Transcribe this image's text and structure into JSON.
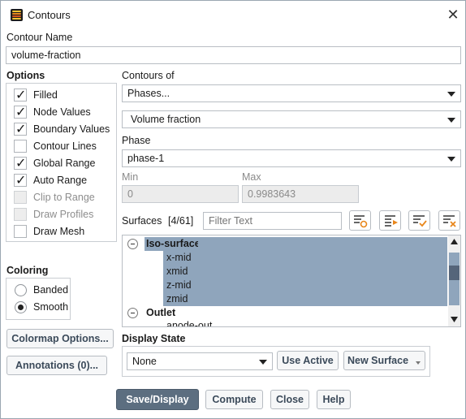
{
  "window": {
    "title": "Contours",
    "close_glyph": "✕",
    "icon": "contours-app-icon"
  },
  "contour_name": {
    "label": "Contour Name",
    "value": "volume-fraction"
  },
  "options": {
    "label": "Options",
    "items": [
      {
        "label": "Filled",
        "checked": true,
        "enabled": true
      },
      {
        "label": "Node Values",
        "checked": true,
        "enabled": true
      },
      {
        "label": "Boundary Values",
        "checked": true,
        "enabled": true
      },
      {
        "label": "Contour Lines",
        "checked": false,
        "enabled": true
      },
      {
        "label": "Global Range",
        "checked": true,
        "enabled": true
      },
      {
        "label": "Auto Range",
        "checked": true,
        "enabled": true
      },
      {
        "label": "Clip to Range",
        "checked": false,
        "enabled": false
      },
      {
        "label": "Draw Profiles",
        "checked": false,
        "enabled": false
      },
      {
        "label": "Draw Mesh",
        "checked": false,
        "enabled": true
      }
    ]
  },
  "contours_of": {
    "label": "Contours of",
    "category": "Phases...",
    "quantity": "Volume fraction"
  },
  "phase": {
    "label": "Phase",
    "value": "phase-1"
  },
  "range": {
    "min_label": "Min",
    "min_value": "0",
    "max_label": "Max",
    "max_value": "0.9983643"
  },
  "surfaces": {
    "label": "Surfaces",
    "count": "[4/61]",
    "filter_placeholder": "Filter Text",
    "tree": [
      {
        "text": "Iso-surface",
        "group": true,
        "selected": true
      },
      {
        "text": "x-mid",
        "group": false,
        "selected": true
      },
      {
        "text": "xmid",
        "group": false,
        "selected": true
      },
      {
        "text": "z-mid",
        "group": false,
        "selected": true
      },
      {
        "text": "zmid",
        "group": false,
        "selected": true
      },
      {
        "text": "Outlet",
        "group": true,
        "selected": false
      },
      {
        "text": "anode-out",
        "group": false,
        "selected": false
      }
    ]
  },
  "coloring": {
    "label": "Coloring",
    "options": [
      {
        "label": "Banded",
        "selected": false
      },
      {
        "label": "Smooth",
        "selected": true
      }
    ]
  },
  "buttons": {
    "colormap": "Colormap Options...",
    "annotations": "Annotations (0)...",
    "use_active": "Use Active",
    "new_surface": "New Surface",
    "save_display": "Save/Display",
    "compute": "Compute",
    "close": "Close",
    "help": "Help"
  },
  "display_state": {
    "label": "Display State",
    "value": "None"
  },
  "colors": {
    "selection": "#8fa5bc",
    "primary_button": "#5c6e80",
    "accent_orange": "#e8861b"
  }
}
